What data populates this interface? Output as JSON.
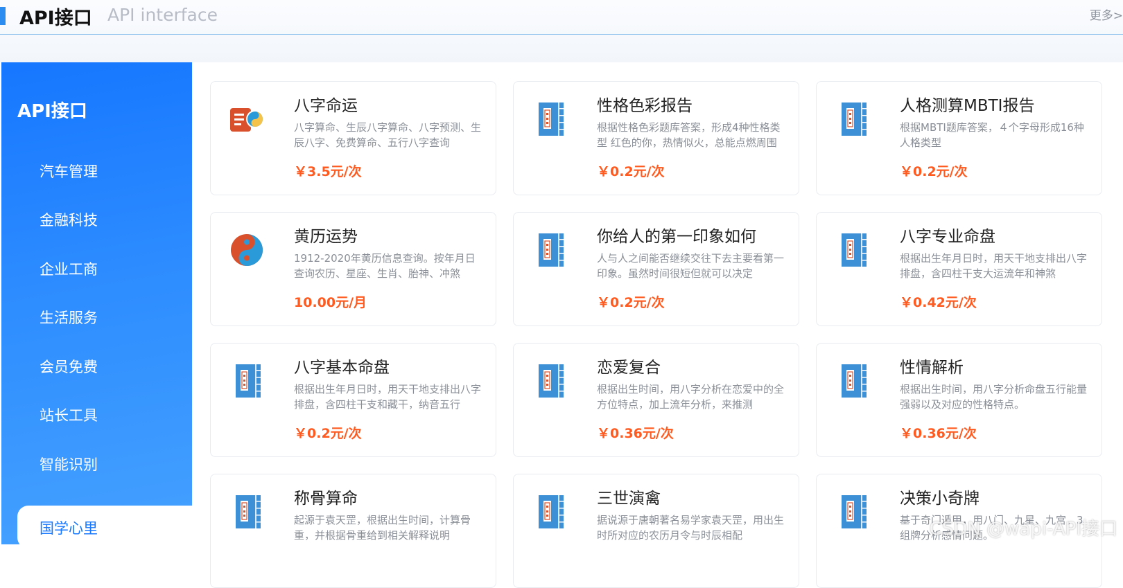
{
  "header": {
    "title": "API接口",
    "subtitle": "API interface",
    "more": "更多>"
  },
  "sidebar": {
    "title": "API接口",
    "items": [
      {
        "label": "汽车管理"
      },
      {
        "label": "金融科技"
      },
      {
        "label": "企业工商"
      },
      {
        "label": "生活服务"
      },
      {
        "label": "会员免费"
      },
      {
        "label": "站长工具"
      },
      {
        "label": "智能识别"
      }
    ],
    "active": {
      "label": "国学心里"
    }
  },
  "cards": [
    {
      "title": "八字命运",
      "desc": "八字算命、生辰八字算命、八字预测、生辰八字、免费算命、五行八字查询",
      "price": "￥3.5元/次",
      "icon": "bazi-icon"
    },
    {
      "title": "性格色彩报告",
      "desc": "根据性格色彩题库答案，形成4种性格类型 红色的你，热情似火，总能点燃周围",
      "price": "￥0.2元/次",
      "icon": "book-icon"
    },
    {
      "title": "人格测算MBTI报告",
      "desc": "根据MBTI题库答案，４个字母形成16种人格类型",
      "price": "￥0.2元/次",
      "icon": "book-icon"
    },
    {
      "title": "黄历运势",
      "desc": "1912-2020年黄历信息查询。按年月日查询农历、星座、生肖、胎神、冲煞",
      "price": "10.00元/月",
      "icon": "yinyang-icon"
    },
    {
      "title": "你给人的第一印象如何",
      "desc": "人与人之间能否继续交往下去主要看第一印象。虽然时间很短但就可以决定",
      "price": "￥0.2元/次",
      "icon": "book-icon"
    },
    {
      "title": "八字专业命盘",
      "desc": "根据出生年月日时，用天干地支排出八字排盘，含四柱干支大运流年和神煞",
      "price": "￥0.42元/次",
      "icon": "book-icon"
    },
    {
      "title": "八字基本命盘",
      "desc": "根据出生年月日时，用天干地支排出八字排盘，含四柱干支和藏干，纳音五行",
      "price": "￥0.2元/次",
      "icon": "book-icon"
    },
    {
      "title": "恋爱复合",
      "desc": "根据出生时间，用八字分析在恋爱中的全方位特点，加上流年分析，来推测",
      "price": "￥0.36元/次",
      "icon": "book-icon"
    },
    {
      "title": "性情解析",
      "desc": "根据出生时间，用八字分析命盘五行能量强弱以及对应的性格特点。",
      "price": "￥0.36元/次",
      "icon": "book-icon"
    },
    {
      "title": "称骨算命",
      "desc": "起源于袁天罡，根据出生时间，计算骨重，并根据骨重给到相关解释说明",
      "price": "",
      "icon": "book-icon"
    },
    {
      "title": "三世演禽",
      "desc": "据说源于唐朝著名易学家袁天罡，用出生时所对应的农历月令与时辰相配",
      "price": "",
      "icon": "book-icon"
    },
    {
      "title": "决策小奇牌",
      "desc": "基于奇门遁甲，用八门、九星、九宫，3组牌分析感情问题。",
      "price": "",
      "icon": "book-icon"
    }
  ],
  "watermark": "CSDN @wapi-API接口",
  "colors": {
    "accent": "#1677ff",
    "price": "#ff5a1f",
    "book": "#3d8fd6",
    "bazi": "#d9512c"
  }
}
